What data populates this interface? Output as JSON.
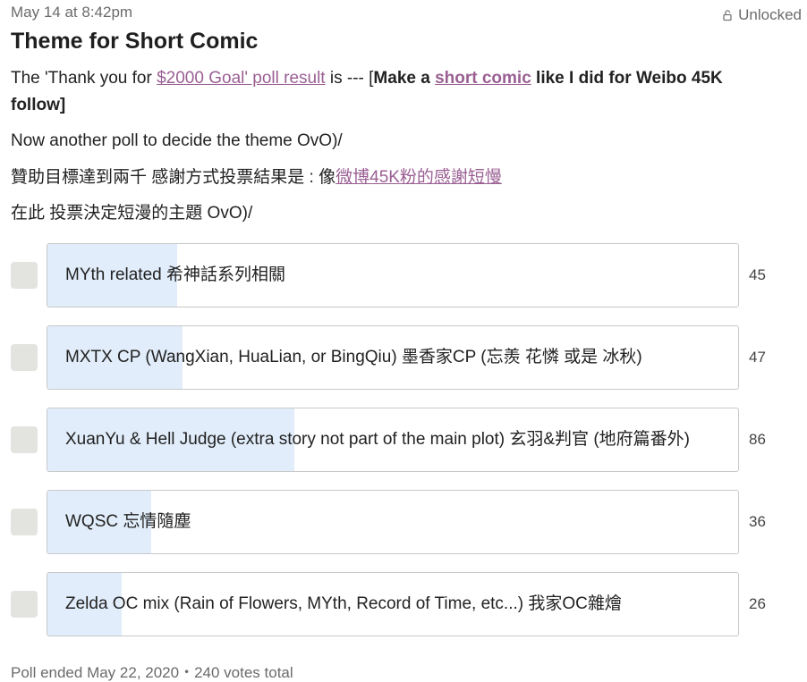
{
  "post": {
    "date": "May 14 at 8:42pm",
    "lock_status": "Unlocked",
    "lock_icon": "unlock-icon",
    "title": "Theme for Short Comic",
    "p1_prefix": "The 'Thank you for ",
    "p1_link": "$2000 Goal' poll result",
    "p1_mid": " is --- [",
    "p1_bold1": "Make a ",
    "p1_bold_link": "short comic",
    "p1_bold2": " like I did for Weibo 45K follow]",
    "p2": "Now another poll to decide the theme OvO)/",
    "p3_text": "贊助目標達到兩千 感謝方式投票結果是 : 像",
    "p3_link": "微博45K粉的感謝短慢",
    "p4": "在此 投票決定短漫的主題 OvO)/"
  },
  "poll": {
    "options": [
      {
        "label": "MYth related 希神話系列相關",
        "votes": 45,
        "fraction": 0.1875
      },
      {
        "label": "MXTX CP (WangXian, HuaLian, or BingQiu) 墨香家CP (忘羨 花憐 或是 冰秋)",
        "votes": 47,
        "fraction": 0.196
      },
      {
        "label": "XuanYu & Hell Judge (extra story not part of the main plot) 玄羽&判官 (地府篇番外)",
        "votes": 86,
        "fraction": 0.358
      },
      {
        "label": "WQSC 忘情隨塵",
        "votes": 36,
        "fraction": 0.15
      },
      {
        "label": "Zelda OC mix (Rain of Flowers, MYth, Record of Time, etc...) 我家OC雜燴",
        "votes": 26,
        "fraction": 0.108
      }
    ],
    "footer": "Poll ended May 22, 2020・240 votes total"
  },
  "colors": {
    "link": "#9a5f93",
    "bar_fill": "#e1edfa",
    "muted_text": "#6b6b6b",
    "checkbox": "#e3e3e0"
  }
}
